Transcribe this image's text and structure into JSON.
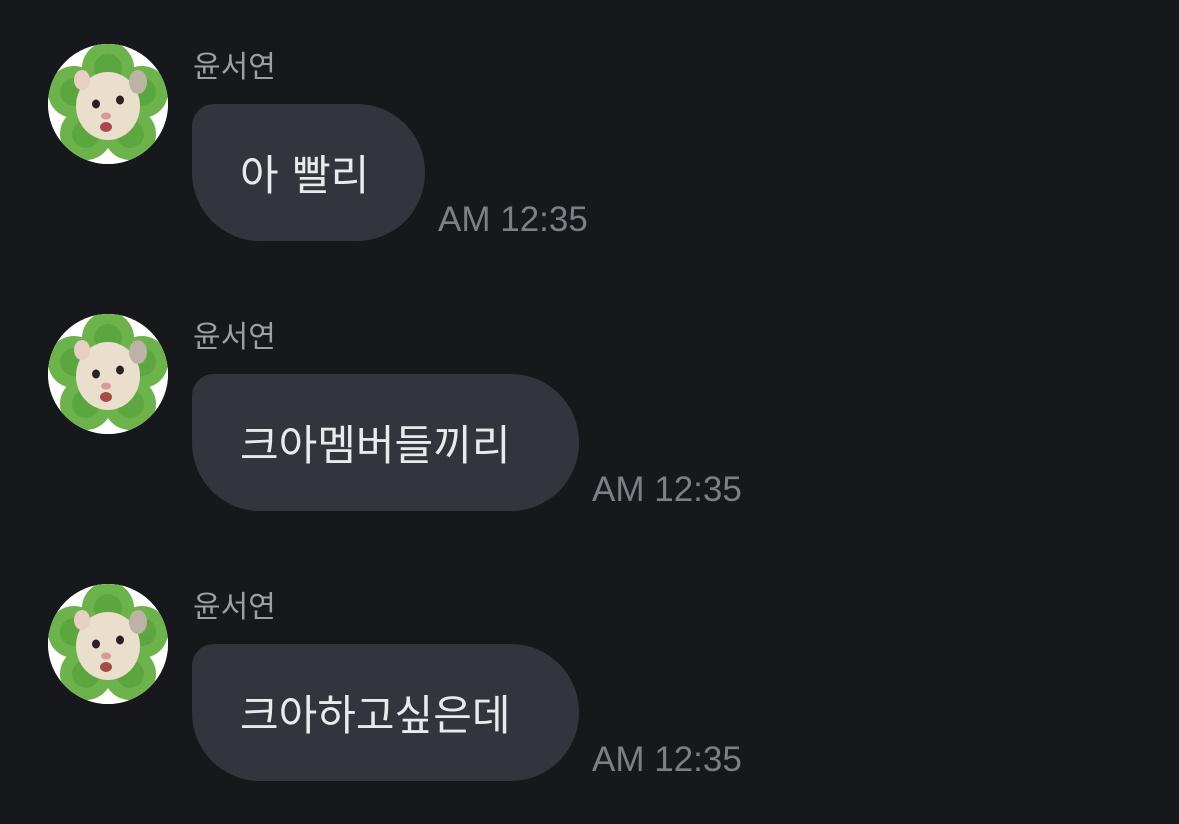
{
  "messages": [
    {
      "sender": "윤서연",
      "text": "아 빨리",
      "time": "AM 12:35",
      "avatar_icon": "hamster-clover-avatar-icon"
    },
    {
      "sender": "윤서연",
      "text": "크아멤버들끼리",
      "time": "AM 12:35",
      "avatar_icon": "hamster-clover-avatar-icon"
    },
    {
      "sender": "윤서연",
      "text": "크아하고싶은데",
      "time": "AM 12:35",
      "avatar_icon": "hamster-clover-avatar-icon"
    }
  ],
  "colors": {
    "background": "#17181c",
    "bubble": "#32353c",
    "bubble_text": "#e9eaec",
    "sender_text": "#9c9ea4",
    "time_text": "#7d7f86",
    "clover_green": "#6bb34a"
  }
}
